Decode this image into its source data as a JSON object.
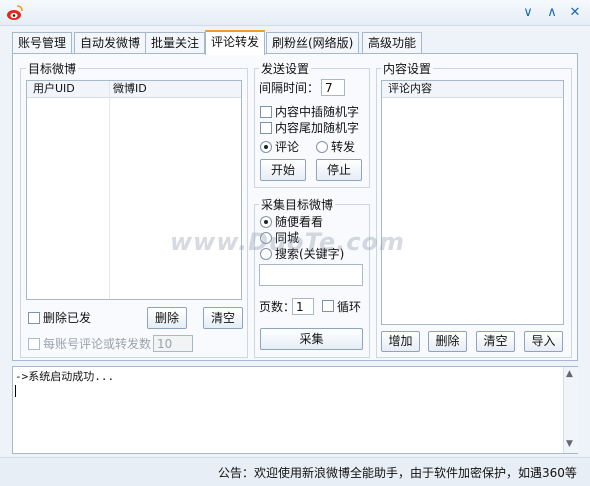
{
  "window": {
    "min_label": "∨",
    "restore_label": "∧",
    "close_label": "✕"
  },
  "tabs": [
    {
      "label": "账号管理"
    },
    {
      "label": "自动发微博"
    },
    {
      "label": "批量关注"
    },
    {
      "label": "评论转发"
    },
    {
      "label": "刷粉丝(网络版)"
    },
    {
      "label": "高级功能"
    }
  ],
  "target": {
    "title": "目标微博",
    "col_uid": "用户UID",
    "col_weibo_id": "微博ID",
    "delete_sent_label": "删除已发",
    "delete_button": "删除",
    "clear_button": "清空",
    "per_account_label": "每账号评论或转发数",
    "per_account_value": "10"
  },
  "send": {
    "title": "发送设置",
    "interval_label": "间隔时间：",
    "interval_value": "7",
    "insert_random_label": "内容中插随机字",
    "append_random_label": "内容尾加随机字",
    "comment_label": "评论",
    "forward_label": "转发",
    "start_button": "开始",
    "stop_button": "停止"
  },
  "collect": {
    "title": "采集目标微博",
    "option_random": "随便看看",
    "option_local": "同城",
    "option_search": "搜索(关键字)",
    "pages_label": "页数：",
    "pages_value": "1",
    "loop_label": "循环",
    "collect_button": "采集"
  },
  "content": {
    "title": "内容设置",
    "col_content": "评论内容",
    "add_button": "增加",
    "delete_button": "删除",
    "clear_button": "清空",
    "import_button": "导入"
  },
  "log": {
    "line": "->系统启动成功..."
  },
  "status": {
    "notice": "公告：欢迎使用新浪微博全能助手，由于软件加密保护，如遇360等"
  },
  "watermark": "www.DuoTe.com"
}
